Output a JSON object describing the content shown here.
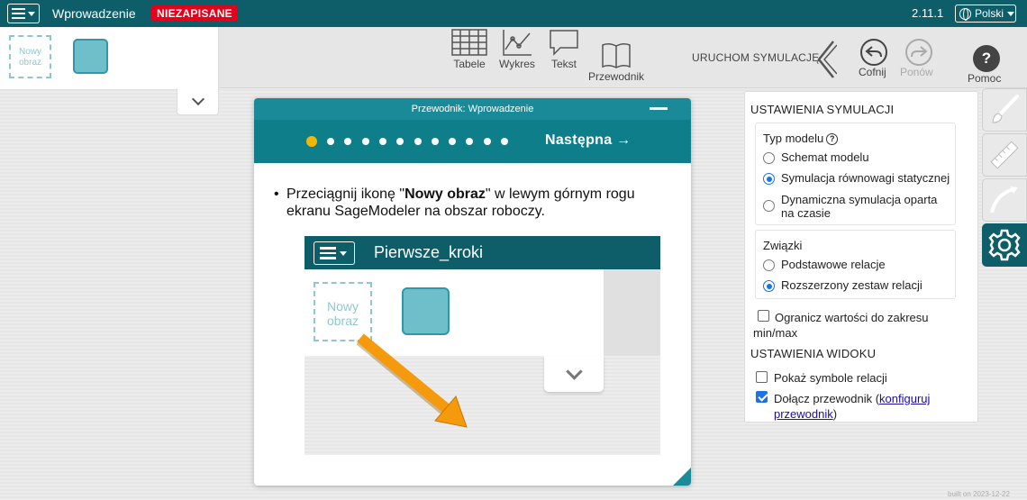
{
  "topbar": {
    "doc_title": "Wprowadzenie",
    "unsaved_badge": "NIEZAPISANE",
    "version": "2.11.1",
    "language": "Polski"
  },
  "palette": {
    "new_image_label": "Nowy obraz"
  },
  "toolbar": {
    "tables": "Tabele",
    "graph": "Wykres",
    "text": "Tekst",
    "guide": "Przewodnik",
    "run_simulation": "URUCHOM SYMULACJĘ",
    "undo": "Cofnij",
    "redo": "Ponów",
    "help": "Pomoc",
    "help_glyph": "?"
  },
  "guide": {
    "title": "Przewodnik: Wprowadzenie",
    "step_count": 12,
    "current_step": 1,
    "next_label": "Następna →",
    "text_before": "Przeciągnij ikonę \"",
    "text_bold": "Nowy obraz",
    "text_after": "\" w lewym górnym rogu ekranu SageModeler na obszar roboczy.",
    "image": {
      "title": "Pierwsze_kroki",
      "new_image_label": "Nowy obraz"
    }
  },
  "settings": {
    "sim_title": "USTAWIENIA SYMULACJI",
    "model_type_label": "Typ modelu",
    "info_glyph": "?",
    "model_types": [
      {
        "label": "Schemat modelu",
        "selected": false
      },
      {
        "label": "Symulacja równowagi statycznej",
        "selected": true
      },
      {
        "label": "Dynamiczna symulacja oparta na czasie",
        "selected": false
      }
    ],
    "relations_label": "Związki",
    "relations": [
      {
        "label": "Podstawowe relacje",
        "selected": false
      },
      {
        "label": "Rozszerzony zestaw relacji",
        "selected": true
      }
    ],
    "limit_values": {
      "label": "Ogranicz wartości do zakresu min/max",
      "checked": false
    },
    "view_title": "USTAWIENIA WIDOKU",
    "show_symbols": {
      "label": "Pokaż symbole relacji",
      "checked": false
    },
    "include_guide": {
      "label_before": "Dołącz przewodnik (",
      "link": "konfiguruj przewodnik",
      "label_after": ")",
      "checked": true
    }
  },
  "footer": {
    "built": "built on 2023-12-22"
  },
  "colors": {
    "topbar": "#0e5e6a",
    "guide_nav": "#0e7e8b",
    "unsaved": "#e2001a",
    "active_dot": "#f2b705",
    "arrow": "#f59a0c",
    "accent": "#1a73e8"
  }
}
